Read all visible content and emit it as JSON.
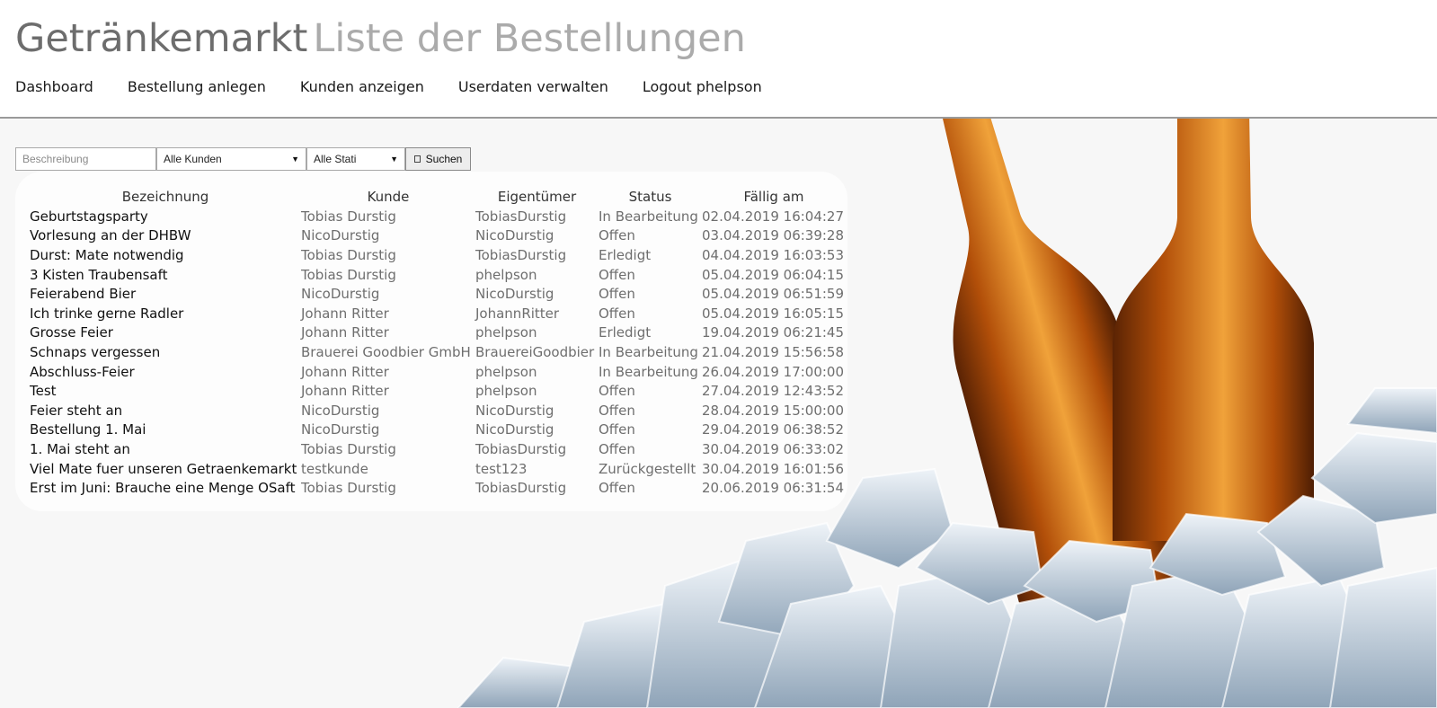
{
  "header": {
    "brand": "Getränkemarkt",
    "subtitle": "Liste der Bestellungen",
    "nav": [
      "Dashboard",
      "Bestellung anlegen",
      "Kunden anzeigen",
      "Userdaten verwalten",
      "Logout phelpson"
    ]
  },
  "search": {
    "description_placeholder": "Beschreibung",
    "customer_selected": "Alle Kunden",
    "status_selected": "Alle Stati",
    "search_button": "Suchen"
  },
  "table": {
    "headers": [
      "Bezeichnung",
      "Kunde",
      "Eigentümer",
      "Status",
      "Fällig am"
    ],
    "rows": [
      [
        "Geburtstagsparty",
        "Tobias Durstig",
        "TobiasDurstig",
        "In Bearbeitung",
        "02.04.2019 16:04:27"
      ],
      [
        "Vorlesung an der DHBW",
        "NicoDurstig",
        "NicoDurstig",
        "Offen",
        "03.04.2019 06:39:28"
      ],
      [
        "Durst: Mate notwendig",
        "Tobias Durstig",
        "TobiasDurstig",
        "Erledigt",
        "04.04.2019 16:03:53"
      ],
      [
        "3 Kisten Traubensaft",
        "Tobias Durstig",
        "phelpson",
        "Offen",
        "05.04.2019 06:04:15"
      ],
      [
        "Feierabend Bier",
        "NicoDurstig",
        "NicoDurstig",
        "Offen",
        "05.04.2019 06:51:59"
      ],
      [
        "Ich trinke gerne Radler",
        "Johann Ritter",
        "JohannRitter",
        "Offen",
        "05.04.2019 16:05:15"
      ],
      [
        "Grosse Feier",
        "Johann Ritter",
        "phelpson",
        "Erledigt",
        "19.04.2019 06:21:45"
      ],
      [
        "Schnaps vergessen",
        "Brauerei Goodbier GmbH",
        "BrauereiGoodbier",
        "In Bearbeitung",
        "21.04.2019 15:56:58"
      ],
      [
        "Abschluss-Feier",
        "Johann Ritter",
        "phelpson",
        "In Bearbeitung",
        "26.04.2019 17:00:00"
      ],
      [
        "Test",
        "Johann Ritter",
        "phelpson",
        "Offen",
        "27.04.2019 12:43:52"
      ],
      [
        "Feier steht an",
        "NicoDurstig",
        "NicoDurstig",
        "Offen",
        "28.04.2019 15:00:00"
      ],
      [
        "Bestellung 1. Mai",
        "NicoDurstig",
        "NicoDurstig",
        "Offen",
        "29.04.2019 06:38:52"
      ],
      [
        "1. Mai steht an",
        "Tobias Durstig",
        "TobiasDurstig",
        "Offen",
        "30.04.2019 06:33:02"
      ],
      [
        "Viel Mate fuer unseren Getraenkemarkt",
        "testkunde",
        "test123",
        "Zurückgestellt",
        "30.04.2019 16:01:56"
      ],
      [
        "Erst im Juni: Brauche eine Menge OSaft",
        "Tobias Durstig",
        "TobiasDurstig",
        "Offen",
        "20.06.2019 06:31:54"
      ]
    ]
  },
  "background": {
    "image": "beer-bottles-on-ice",
    "colors": {
      "beer": "#c4620e",
      "ice": "#c9d6e2"
    }
  }
}
